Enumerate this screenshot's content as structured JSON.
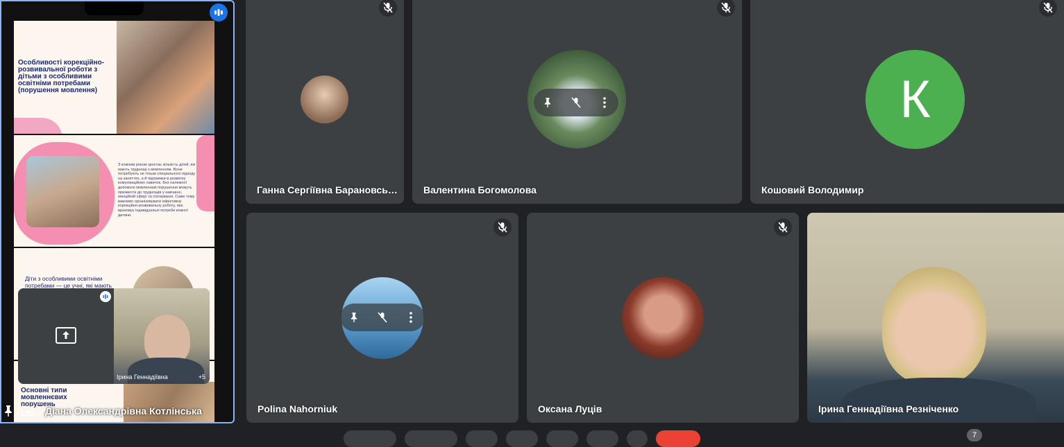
{
  "presentation": {
    "presenter_name": "Діана Олександрівна Котлінська",
    "slide1_title": "Особливості корекційно-розвивальної роботи з дітьми з особливими освітніми потребами (порушення мовлення)",
    "slide2_text": "З кожним роком зростає кількість дітей, які мають труднощі з мовленням. Вони потребують не тільки спеціального підходу на заняттях, а й підтримки в розвитку комунікаційних навичок. Без належної допомоги мовленнєві порушення можуть призвести до труднощів у навчанні, емоційній сфері та спілкуванні. Саме тому важливо організовувати ефективну корекційно-розвивальну роботу, яка враховує індивідуальні потреби кожної дитини.",
    "slide3_text": "Діти з особливими освітніми потребами — це учні, які мають порушення у",
    "slide4_title": "Основні типи мовленнєвих порушень",
    "pip_name": "Ірина Геннадіївна",
    "pip_more": "+5"
  },
  "participants": [
    {
      "name": "Ганна Сергіївна Барановсь…",
      "avatar_color": "#c9a58a"
    },
    {
      "name": "Валентина Богомолова",
      "avatar_color": "#5b7b5a"
    },
    {
      "name": "Кошовий Володимир",
      "initial": "К",
      "avatar_color": "#4caf50"
    },
    {
      "name": "Polina Nahorniuk",
      "avatar_color": "#4b8fc9"
    },
    {
      "name": "Оксана Луців",
      "avatar_color": "#b86d52"
    },
    {
      "name": "Ірина Геннадіївна Резніченко",
      "avatar_color": "#b9b19c"
    }
  ],
  "toolbar": {
    "people_count": "7"
  },
  "icons": [
    "mic-off-icon",
    "pin-icon",
    "more-vert-icon",
    "present-icon",
    "speaking-icon"
  ]
}
